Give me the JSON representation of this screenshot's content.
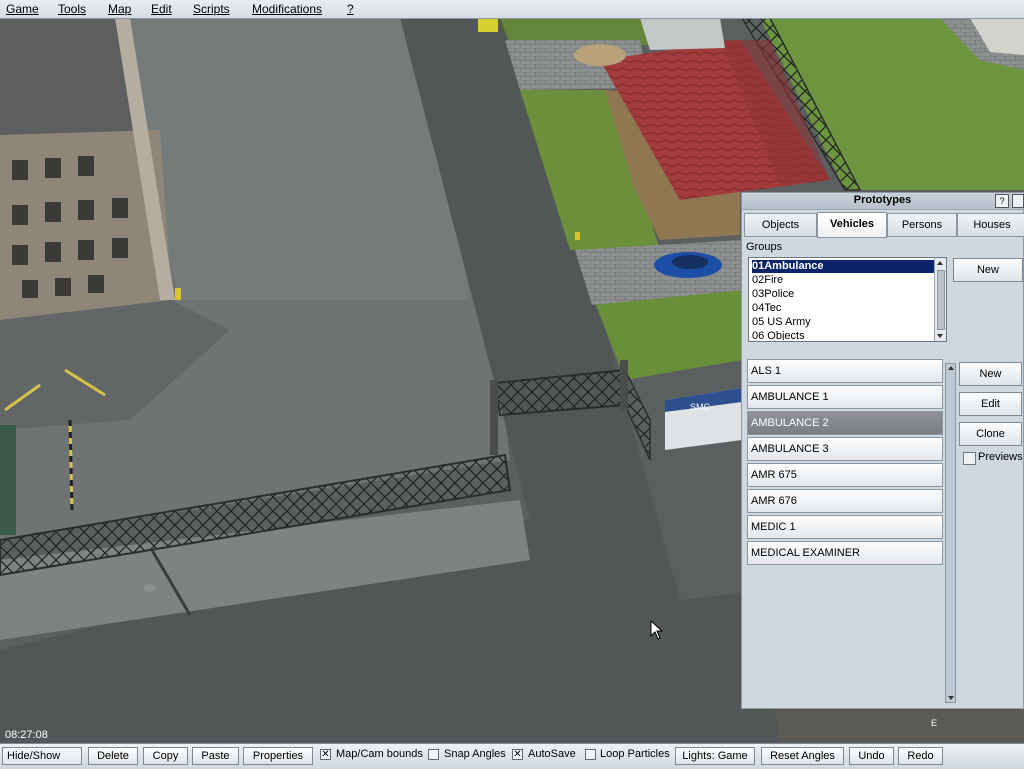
{
  "menu": {
    "game": "Game",
    "tools": "Tools",
    "map": "Map",
    "edit": "Edit",
    "scripts": "Scripts",
    "modifications": "Modifications",
    "help": "?"
  },
  "clock": "08:27:08",
  "prototypes": {
    "title": "Prototypes",
    "help_label": "?",
    "tabs": [
      "Objects",
      "Vehicles",
      "Persons",
      "Houses"
    ],
    "active_tab": "Vehicles",
    "groups_label": "Groups",
    "groups": [
      "01Ambulance",
      "02Fire",
      "03Police",
      "04Tec",
      "05 US Army",
      "06 Objects"
    ],
    "selected_group": "01Ambulance",
    "group_new_label": "New",
    "vehicles": [
      "ALS 1",
      "AMBULANCE 1",
      "AMBULANCE 2",
      "AMBULANCE 3",
      "AMR 675",
      "AMR 676",
      "MEDIC 1",
      "MEDICAL EXAMINER"
    ],
    "selected_vehicle": "AMBULANCE 2",
    "new_label": "New",
    "edit_label": "Edit",
    "clone_label": "Clone",
    "previews_label": "Previews",
    "previews_checked": false
  },
  "toolbar": {
    "hide_show": "Hide/Show",
    "delete": "Delete",
    "copy": "Copy",
    "paste": "Paste",
    "properties": "Properties",
    "map_cam_bounds": "Map/Cam bounds",
    "map_cam_bounds_checked": true,
    "snap_angles": "Snap Angles",
    "snap_angles_checked": false,
    "autosave": "AutoSave",
    "autosave_checked": true,
    "loop_particles": "Loop Particles",
    "loop_particles_checked": false,
    "lights": "Lights: Game",
    "reset_angles": "Reset Angles",
    "undo": "Undo",
    "redo": "Redo"
  },
  "scene": {
    "banner_text": "SMC"
  },
  "colors": {
    "selection": "#0a246a",
    "panel_bg": "#cfd7df",
    "grass": "#6b8f3a",
    "asphalt": "#5e6263",
    "roof": "#a4393b"
  }
}
